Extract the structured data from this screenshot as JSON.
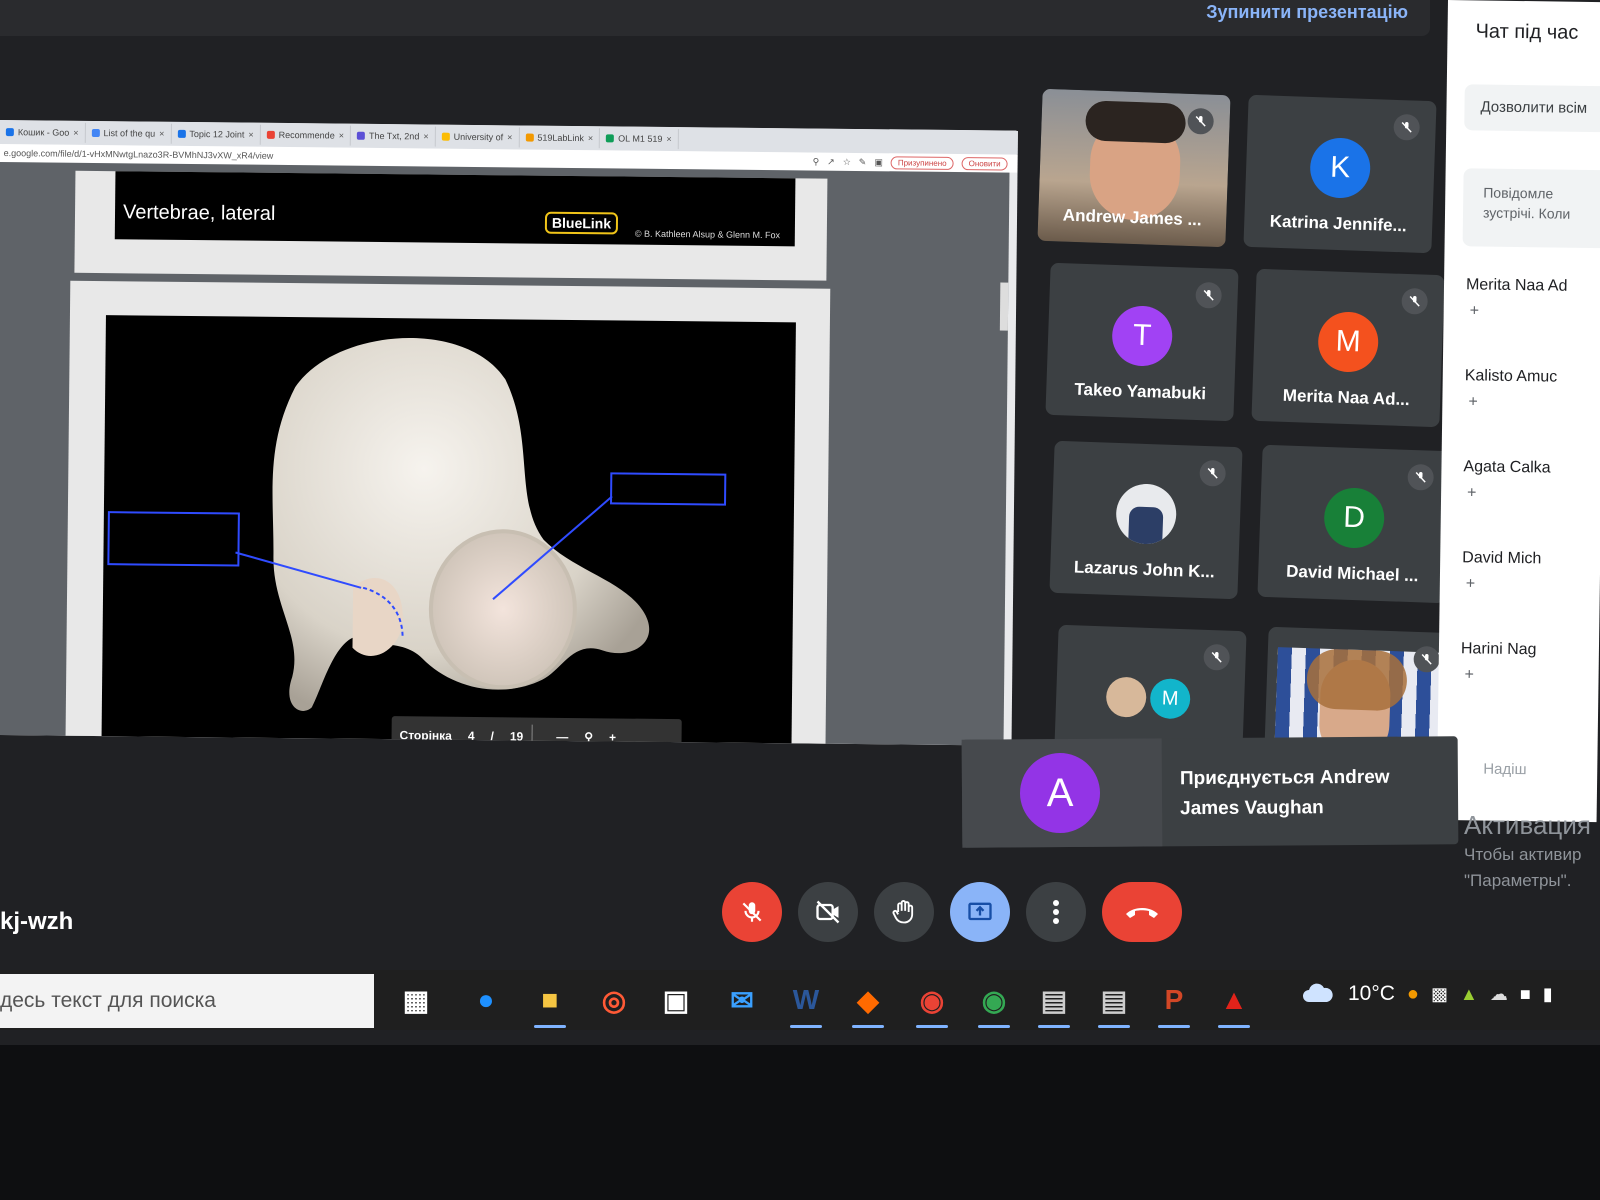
{
  "banner": {
    "stop_presenting": "Зупинити презентацію"
  },
  "browser": {
    "tabs": [
      {
        "label": "Кошик - Goo",
        "icon": "drive-icon",
        "color": "#1a73e8"
      },
      {
        "label": "List of the qu",
        "icon": "docs-icon",
        "color": "#4285f4"
      },
      {
        "label": "Topic 12 Joint",
        "icon": "person-icon",
        "color": "#1a73e8"
      },
      {
        "label": "Recommende",
        "icon": "gmail-icon",
        "color": "#ea4335"
      },
      {
        "label": "The Txt, 2nd",
        "icon": "book-icon",
        "color": "#5b4fd6"
      },
      {
        "label": "University of",
        "icon": "page-icon",
        "color": "#fbbc04"
      },
      {
        "label": "519LabLink",
        "icon": "folder-icon",
        "color": "#f29900"
      },
      {
        "label": "OL M1 519 ",
        "icon": "drive-icon",
        "color": "#0f9d58"
      }
    ],
    "url": "e.google.com/file/d/1-vHxMNwtgLnazo3R-BVMhNJ3vXW_xR4/view",
    "paused_label": "Призупинено",
    "update_label": "Оновити",
    "slide": {
      "title": "Vertebrae, lateral",
      "brand": "BlueLink",
      "credit": "© B. Kathleen Alsup & Glenn M. Fox"
    },
    "pager": {
      "label": "Сторінка",
      "current": "4",
      "slash": "/",
      "total": "19",
      "minus": "—",
      "plus": "+"
    }
  },
  "participants": [
    {
      "name": "Andrew James ...",
      "initial": "",
      "color": "#8d6e63",
      "type": "photo"
    },
    {
      "name": "Katrina Jennife...",
      "initial": "K",
      "color": "#1a73e8",
      "type": "initial"
    },
    {
      "name": "Takeo Yamabuki",
      "initial": "T",
      "color": "#a142f4",
      "type": "initial"
    },
    {
      "name": "Merita Naa Ad...",
      "initial": "M",
      "color": "#f4511e",
      "type": "initial"
    },
    {
      "name": "Lazarus John K...",
      "initial": "",
      "color": "#dfe1e5",
      "type": "photo"
    },
    {
      "name": "David Michael ...",
      "initial": "D",
      "color": "#188038",
      "type": "initial"
    },
    {
      "name": "",
      "initial": "M",
      "color": "#12b5cb",
      "type": "group"
    },
    {
      "name": "",
      "initial": "",
      "color": "#3c5aa6",
      "type": "photo"
    }
  ],
  "chat": {
    "title": "Чат під час",
    "allow": "Дозволити всім",
    "note_line1": "Повідомле",
    "note_line2": "зустрічі. Коли",
    "people": [
      "Merita Naa Ad",
      "Kalisto Amuc",
      "Agata Calka",
      "David Mich",
      "Harini Nag"
    ],
    "plus": "+",
    "send_placeholder": "Надіш"
  },
  "toast": {
    "initial": "A",
    "message": "Приєднується Andrew James Vaughan"
  },
  "activation": {
    "title": "Активация",
    "line1": "Чтобы активир",
    "line2": "\"Параметры\"."
  },
  "meeting_code": "kj-wzh",
  "taskbar": {
    "search_placeholder": "десь текст для поиска",
    "temperature": "10°C"
  },
  "colors": {
    "accent_blue": "#8ab4f8",
    "danger_red": "#ea4335",
    "meet_bg": "#202124"
  }
}
